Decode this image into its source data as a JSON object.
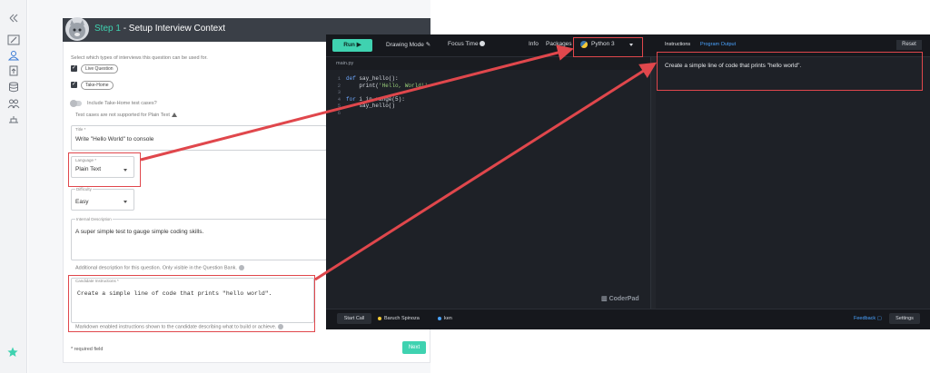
{
  "form": {
    "step_label": "Step 1",
    "step_title": " - Setup Interview Context",
    "interview_types_prompt": "Select which types of interviews this question can be used for.",
    "type_live": "Live Question",
    "type_takehome": "Take-Home",
    "include_takehome": "Include Take-Home test cases?",
    "testcases_note": "Test cases are not supported for Plain Text",
    "title_label": "Title *",
    "title_value": "Write \"Hello World\" to console",
    "language_label": "Language *",
    "language_value": "Plain Text",
    "difficulty_label": "Difficulty",
    "difficulty_value": "Easy",
    "internal_desc_label": "Internal Description",
    "internal_desc_value": "A super simple test to gauge simple coding skills.",
    "internal_desc_help": "Additional description for this question. Only visible in the Question Bank.",
    "candidate_label": "Candidate Instructions *",
    "candidate_value": "Create a simple line of code that prints \"hello world\".",
    "candidate_help": "Markdown enabled instructions shown to the candidate describing what to build or achieve.",
    "required_note": "* required field",
    "next_label": "Next"
  },
  "editor": {
    "run_label": "Run",
    "drawing_mode": "Drawing Mode",
    "focus_time": "Focus Time",
    "info": "Info",
    "packages": "Packages",
    "language": "Python 3",
    "file_tab": "main.py",
    "line_numbers": [
      "1",
      "2",
      "3",
      "4",
      "5",
      "6"
    ],
    "code": {
      "l1_kw": "def",
      "l1_rest": " say_hello():",
      "l2_pre": "    print(",
      "l2_str": "'Hello, World!'",
      "l4_kw": "for",
      "l4_rest": " i in range(5):",
      "l5": "    say_hello()"
    },
    "watermark": "CoderPad",
    "tab_instructions": "Instructions",
    "tab_output": "Program Output",
    "reset_label": "Reset",
    "instructions_text": "Create a simple line of code that prints \"hello world\".",
    "start_call": "Start Call",
    "user1": "Baruch Spinoza",
    "user2": "ken",
    "feedback": "Feedback",
    "settings": "Settings"
  },
  "colors": {
    "accent": "#3fd2b0",
    "highlight": "#e0474c",
    "editor_bg": "#1e2127"
  }
}
